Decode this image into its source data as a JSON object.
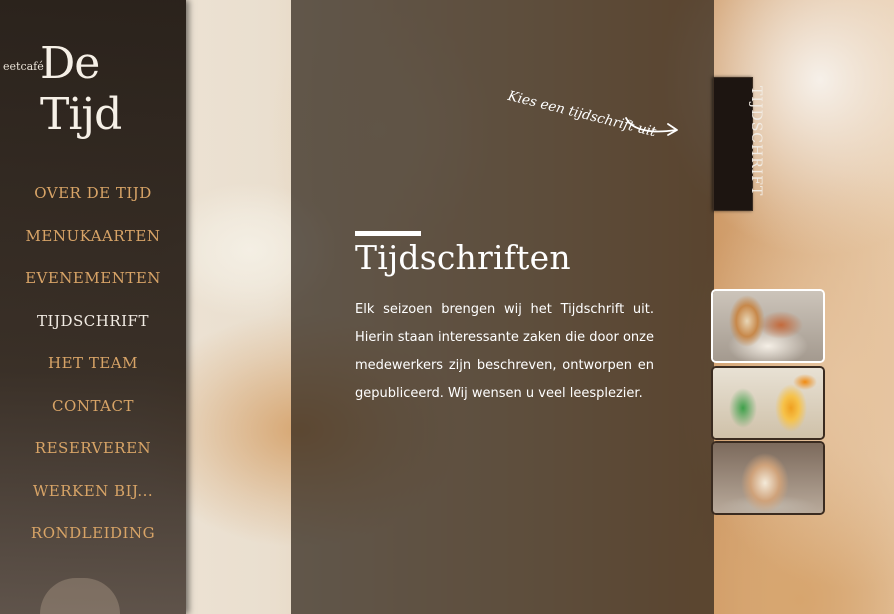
{
  "brand": {
    "prefix": "eetcafé",
    "name": "De Tijd"
  },
  "nav": {
    "items": [
      {
        "label": "OVER DE TIJD",
        "active": false
      },
      {
        "label": "MENUKAARTEN",
        "active": false
      },
      {
        "label": "EVENEMENTEN",
        "active": false
      },
      {
        "label": "TIJDSCHRIFT",
        "active": true
      },
      {
        "label": "HET TEAM",
        "active": false
      },
      {
        "label": "CONTACT",
        "active": false
      },
      {
        "label": "RESERVEREN",
        "active": false
      },
      {
        "label": "WERKEN BIJ...",
        "active": false
      },
      {
        "label": "RONDLEIDING",
        "active": false
      }
    ]
  },
  "hint": {
    "text": "Kies een tijdschrift uit"
  },
  "vertical_tab": {
    "label": "TIJDSCHRIFT"
  },
  "main": {
    "title": "Tijdschriften",
    "body": "Elk seizoen brengen wij het Tijdschrift uit. Hierin staan interessante zaken die door onze medewerkers  zijn beschreven, ontworpen en gepubliceerd. Wij wensen u veel leesplezier."
  },
  "colors": {
    "nav_text": "#d8a467",
    "nav_active": "#f2ece4",
    "panel_overlay": "rgba(45,34,25,0.72)"
  },
  "icons": {
    "hint_arrow": "arrow-right-icon"
  }
}
